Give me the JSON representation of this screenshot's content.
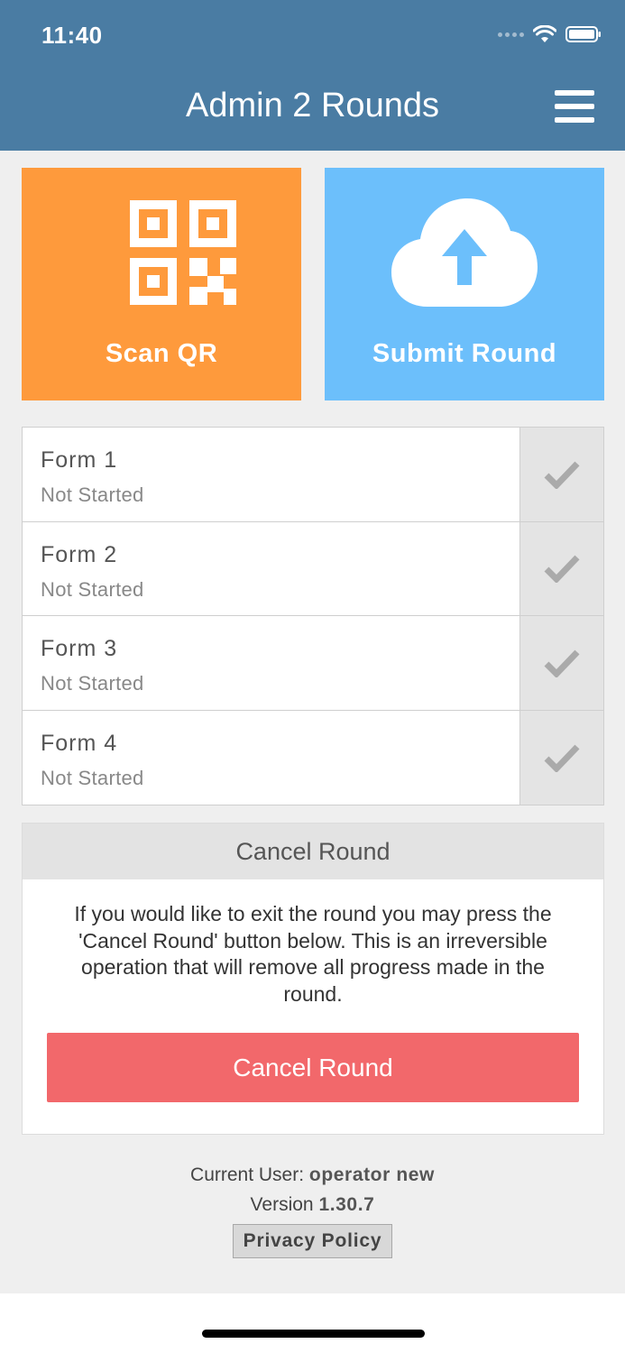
{
  "status_bar": {
    "time": "11:40"
  },
  "header": {
    "title": "Admin 2 Rounds",
    "menu_icon": "hamburger-menu-icon"
  },
  "actions": {
    "scan_label": "Scan QR",
    "scan_icon": "qr-code-icon",
    "submit_label": "Submit Round",
    "submit_icon": "cloud-upload-icon",
    "scan_color": "#fe9a3c",
    "submit_color": "#6cbffb"
  },
  "forms": [
    {
      "name": "Form 1",
      "status": "Not Started"
    },
    {
      "name": "Form 2",
      "status": "Not Started"
    },
    {
      "name": "Form 3",
      "status": "Not Started"
    },
    {
      "name": "Form 4",
      "status": "Not Started"
    }
  ],
  "cancel_panel": {
    "heading": "Cancel Round",
    "message": "If you would like to exit the round you may press the 'Cancel Round' button below. This is an irreversible operation that will remove all progress made in the round.",
    "button_label": "Cancel Round",
    "button_color": "#f2686b"
  },
  "footer": {
    "user_label": "Current User:",
    "user_name": "operator new",
    "version_label": "Version",
    "version_number": "1.30.7",
    "privacy_label": "Privacy Policy"
  },
  "colors": {
    "header": "#4a7ca3",
    "background": "#efefef"
  }
}
